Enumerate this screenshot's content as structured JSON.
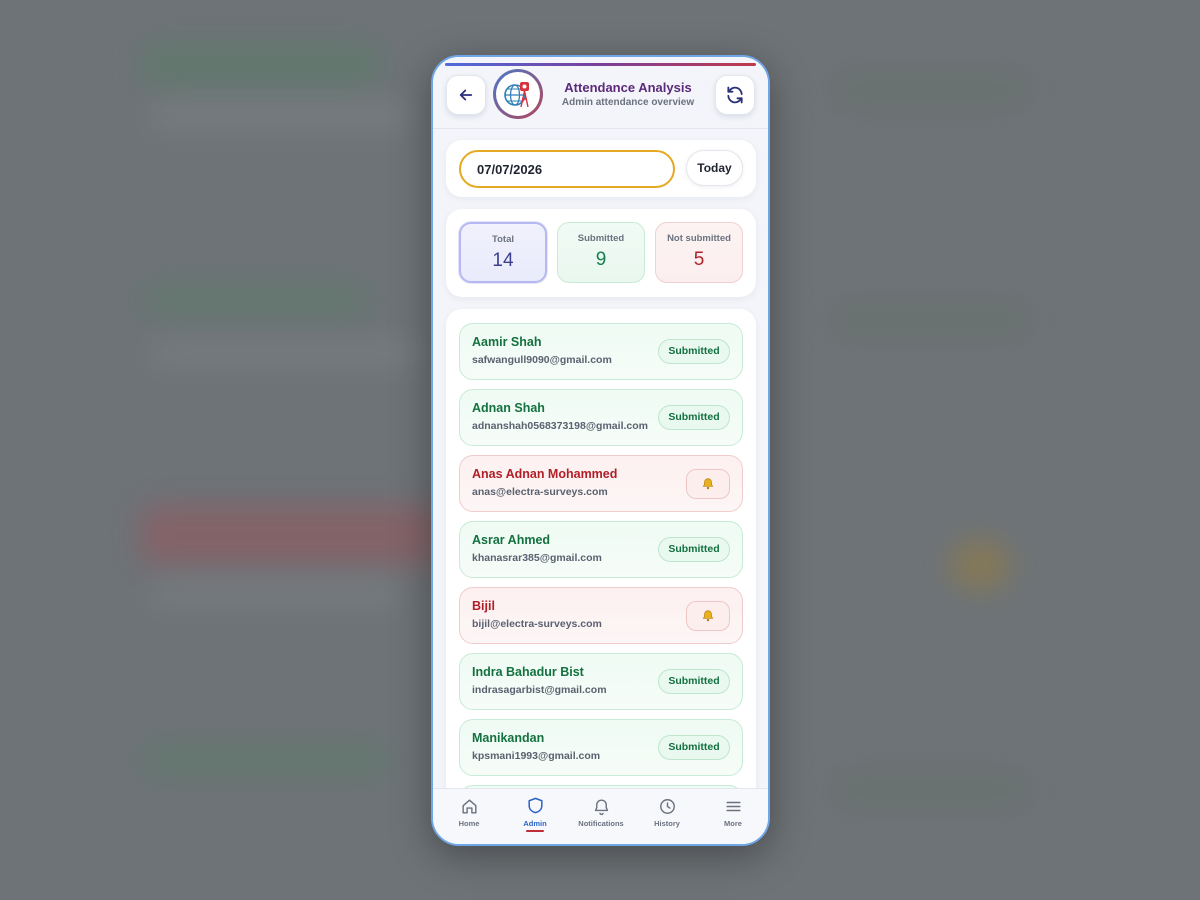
{
  "colors": {
    "accent": "#2c63c5",
    "title": "#5b2a7a",
    "submitted": "#13713f",
    "not_submitted": "#b21e27",
    "date_border": "#e5a922"
  },
  "header": {
    "title": "Attendance Analysis",
    "subtitle": "Admin attendance overview",
    "back_icon": "arrow-left-icon",
    "refresh_icon": "refresh-icon",
    "logo_icon": "globe-tower-logo"
  },
  "date_filter": {
    "value": "07/07/2026",
    "today_label": "Today"
  },
  "stats": {
    "total_label": "Total",
    "total_value": "14",
    "submitted_label": "Submitted",
    "submitted_value": "9",
    "not_submitted_label": "Not submitted",
    "not_submitted_value": "5"
  },
  "employees": [
    {
      "name": "Aamir Shah",
      "email": "safwangull9090@gmail.com",
      "status": "Submitted"
    },
    {
      "name": "Adnan Shah",
      "email": "adnanshah0568373198@gmail.com",
      "status": "Submitted"
    },
    {
      "name": "Anas Adnan Mohammed",
      "email": "anas@electra-surveys.com",
      "status": "bell"
    },
    {
      "name": "Asrar Ahmed",
      "email": "khanasrar385@gmail.com",
      "status": "Submitted"
    },
    {
      "name": "Bijil",
      "email": "bijil@electra-surveys.com",
      "status": "bell"
    },
    {
      "name": "Indra Bahadur Bist",
      "email": "indrasagarbist@gmail.com",
      "status": "Submitted"
    },
    {
      "name": "Manikandan",
      "email": "kpsmani1993@gmail.com",
      "status": "Submitted"
    }
  ],
  "nav": {
    "home": "Home",
    "admin": "Admin",
    "notifications": "Notifications",
    "history": "History",
    "more": "More"
  }
}
